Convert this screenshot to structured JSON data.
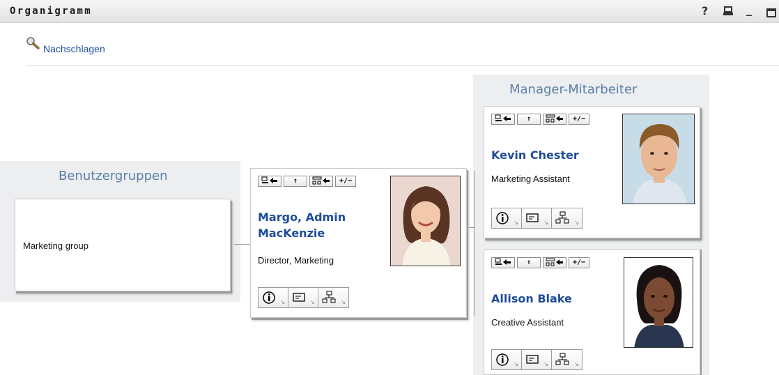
{
  "window": {
    "title": "Organigramm",
    "help": "?",
    "print_icon": "print-icon",
    "minimize": "_",
    "maximize_icon": "maximize-icon"
  },
  "lookup": {
    "label": "Nachschlagen",
    "icon": "magnifier-icon"
  },
  "groups_panel": {
    "title": "Benutzergruppen",
    "items": [
      {
        "label": "Marketing group"
      }
    ]
  },
  "manager_panel": {
    "title": "Manager-Mitarbeiter"
  },
  "toolbar_buttons": {
    "select_root": "select-root-icon",
    "up": "↑",
    "expand": "expand-icon",
    "toggle": "+/−"
  },
  "action_buttons": [
    "info-icon",
    "message-icon",
    "org-chart-icon"
  ],
  "people": {
    "center": {
      "name_line1": "Margo, Admin",
      "name_line2": "MacKenzie",
      "title": "Director, Marketing"
    },
    "report1": {
      "name": "Kevin Chester",
      "title": "Marketing Assistant"
    },
    "report2": {
      "name": "Allison Blake",
      "title": "Creative Assistant"
    }
  },
  "colors": {
    "link": "#1f4c9a",
    "panel_title": "#5a7fa8",
    "panel_bg": "#eceef0"
  }
}
